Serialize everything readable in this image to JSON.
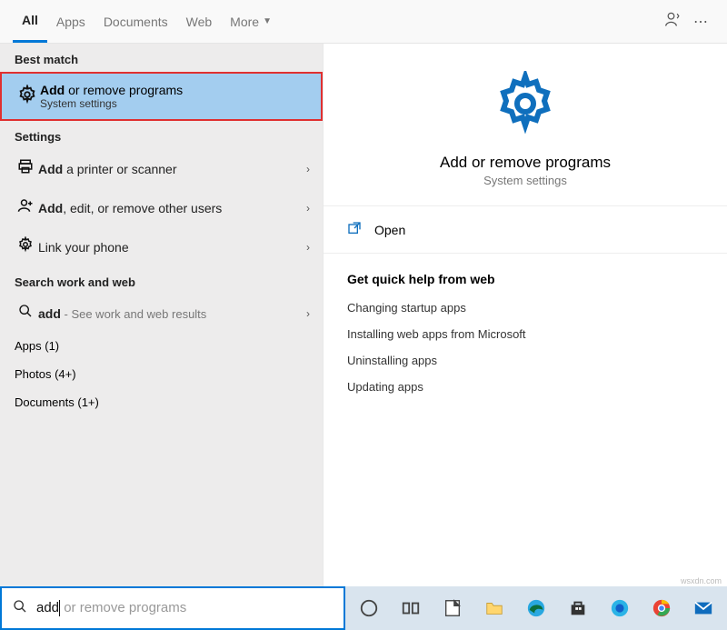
{
  "tabs": {
    "all": "All",
    "apps": "Apps",
    "documents": "Documents",
    "web": "Web",
    "more": "More"
  },
  "sections": {
    "best_match": "Best match",
    "settings": "Settings",
    "search_hdr": "Search work and web",
    "apps_count": "Apps (1)",
    "photos_count": "Photos (4+)",
    "docs_count": "Documents (1+)"
  },
  "best": {
    "bold": "Add",
    "rest": " or remove programs",
    "sub": "System settings"
  },
  "settings_rows": [
    {
      "icon": "printer",
      "bold": "Add",
      "rest": " a printer or scanner"
    },
    {
      "icon": "person",
      "bold": "Add",
      "rest": ", edit, or remove other users"
    },
    {
      "icon": "gear",
      "bold": "",
      "rest": "Link your phone"
    }
  ],
  "web_row": {
    "bold": "add",
    "rest": " - See work and web results"
  },
  "preview": {
    "title": "Add or remove programs",
    "sub": "System settings",
    "open": "Open",
    "help_title": "Get quick help from web",
    "help_items": [
      "Changing startup apps",
      "Installing web apps from Microsoft",
      "Uninstalling apps",
      "Updating apps"
    ]
  },
  "search": {
    "typed": "add",
    "ghost": " or remove programs"
  },
  "watermark": "wsxdn.com"
}
